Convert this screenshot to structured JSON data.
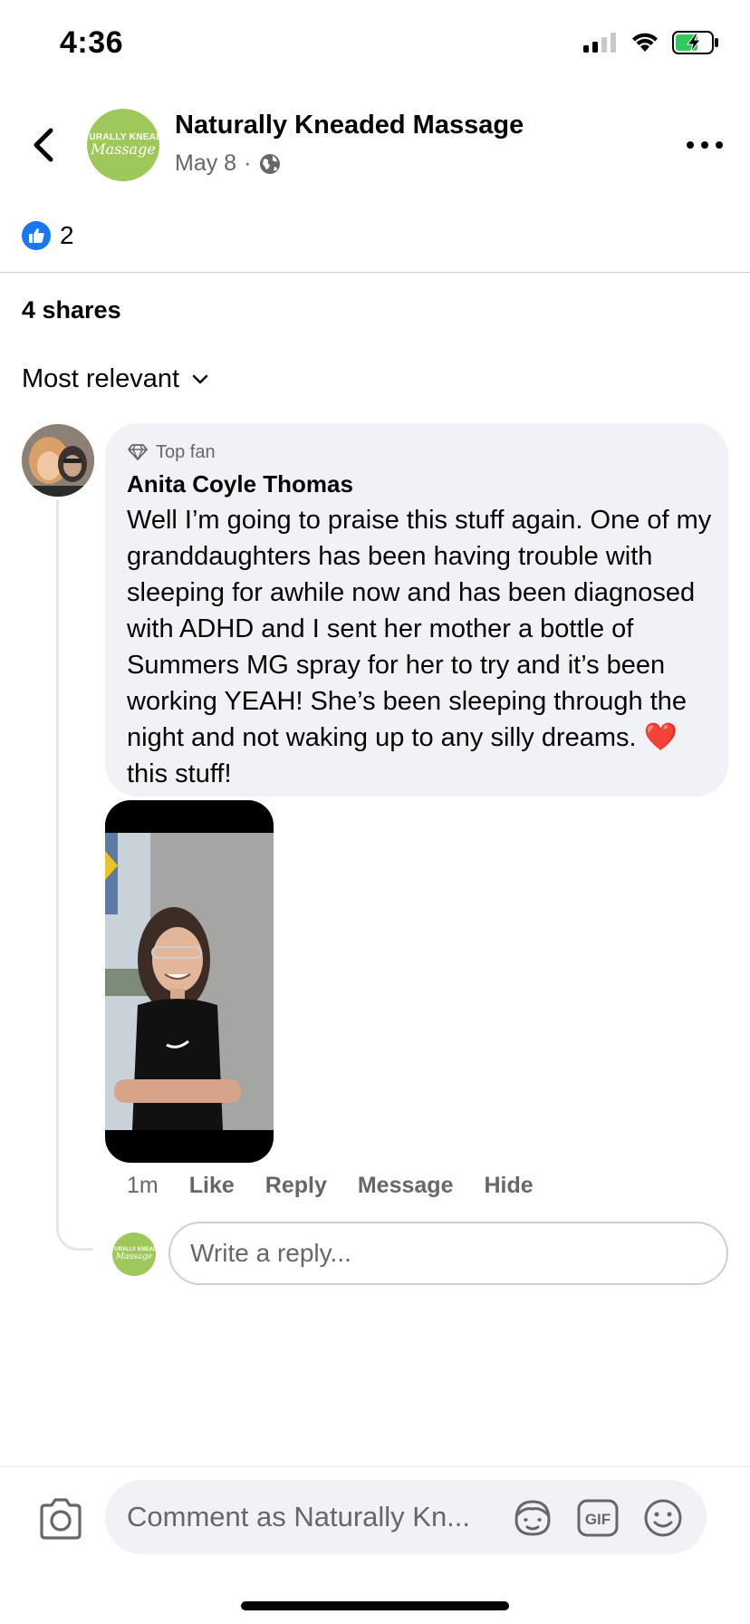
{
  "status_bar": {
    "time": "4:36",
    "icons": [
      "cellular-signal-icon",
      "wifi-icon",
      "battery-charging-icon"
    ]
  },
  "post": {
    "page_name": "Naturally Kneaded Massage",
    "avatar_text_top": "NATURALLY KNEADED",
    "avatar_text_bottom": "Massage",
    "date": "May 8",
    "separator": "·",
    "audience_icon": "globe-icon",
    "reaction_icon": "like-icon",
    "reaction_count": "2",
    "shares": "4 shares"
  },
  "comments_section": {
    "sort_label": "Most relevant",
    "comment": {
      "badge": "Top fan",
      "badge_icon": "diamond-icon",
      "author": "Anita Coyle Thomas",
      "text": "Well I’m going to praise this stuff again. One of my granddaughters has been having trouble with sleeping for awhile now and has been diagnosed with ADHD and I sent her mother a bottle of Summers MG spray for her to try and it’s been working YEAH! She’s been sleeping through the night and not waking up to any silly dreams.",
      "heart": "❤️",
      "text_end": "this stuff!",
      "time": "1m",
      "actions": {
        "like": "Like",
        "reply": "Reply",
        "message": "Message",
        "hide": "Hide"
      }
    },
    "reply_placeholder": "Write a reply..."
  },
  "composer": {
    "placeholder": "Comment as Naturally Kn...",
    "icons": [
      "camera-icon",
      "avatar-sticker-icon",
      "gif-icon",
      "emoji-icon"
    ],
    "gif_label": "GIF"
  },
  "colors": {
    "brand_blue": "#1877f2",
    "bubble_bg": "#f0f2f5",
    "secondary_text": "#65676b",
    "page_green": "#9fc85a",
    "heart_red": "#e0245e"
  }
}
